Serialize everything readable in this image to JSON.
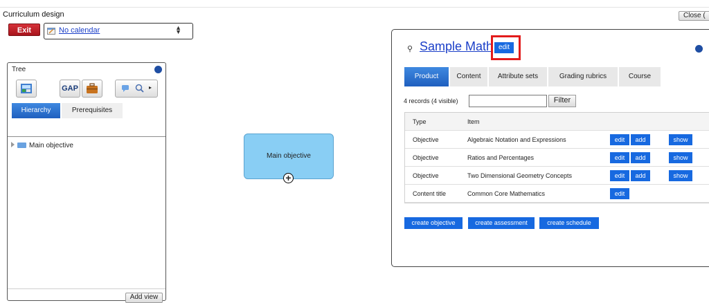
{
  "app": {
    "title": "Curriculum design",
    "close_label": "Close ("
  },
  "toolbar": {
    "exit_label": "Exit",
    "calendar_value": "No calendar"
  },
  "tree": {
    "title": "Tree",
    "gap_label": "GAP",
    "tabs": [
      {
        "label": "Hierarchy"
      },
      {
        "label": "Prerequisites"
      }
    ],
    "node_label": "Main objective",
    "add_view_label": "Add view"
  },
  "canvas": {
    "node_label": "Main objective",
    "expand_glyph": "+"
  },
  "detail": {
    "title": "Sample Math",
    "edit_label": "edit",
    "tabs": [
      {
        "label": "Product"
      },
      {
        "label": "Content"
      },
      {
        "label": "Attribute sets"
      },
      {
        "label": "Grading rubrics"
      },
      {
        "label": "Course"
      }
    ],
    "records_label": "4 records  (4 visible)",
    "filter_label": "Filter",
    "table": {
      "headers": {
        "type": "Type",
        "item": "Item"
      },
      "rows": [
        {
          "type": "Objective",
          "item": "Algebraic Notation and Expressions",
          "edit": "edit",
          "add": "add",
          "show": "show"
        },
        {
          "type": "Objective",
          "item": "Ratios and Percentages",
          "edit": "edit",
          "add": "add",
          "show": "show"
        },
        {
          "type": "Objective",
          "item": "Two Dimensional Geometry Concepts",
          "edit": "edit",
          "add": "add",
          "show": "show"
        },
        {
          "type": "Content title",
          "item": "Common Core Mathematics",
          "edit": "edit"
        }
      ]
    },
    "actions": {
      "create_objective": "create objective",
      "create_assessment": "create assessment",
      "create_schedule": "create schedule"
    }
  },
  "colors": {
    "accent": "#1769e0",
    "highlight": "#e21b1b",
    "node_fill": "#89cef4",
    "exit": "#c0202a"
  }
}
